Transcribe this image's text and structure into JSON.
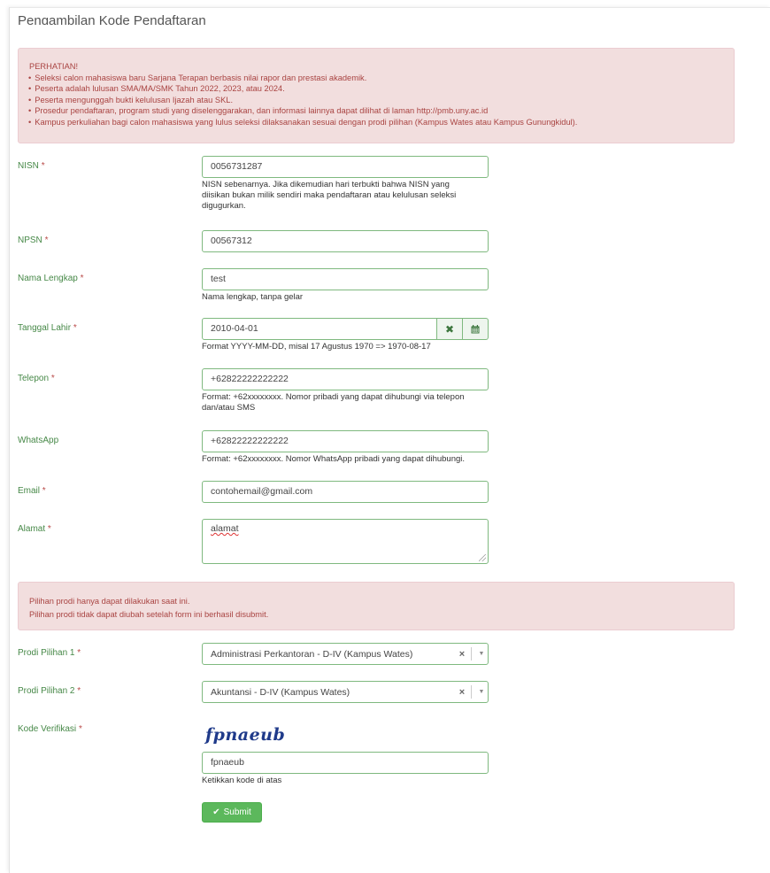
{
  "page": {
    "title": "Pengambilan Kode Pendaftaran"
  },
  "notice": {
    "heading": "PERHATIAN!",
    "items": [
      "Seleksi calon mahasiswa baru Sarjana Terapan berbasis nilai rapor dan prestasi akademik.",
      "Peserta adalah lulusan SMA/MA/SMK Tahun 2022, 2023, atau 2024.",
      "Peserta mengunggah bukti kelulusan Ijazah atau SKL.",
      "Prosedur pendaftaran, program studi yang diselenggarakan, dan informasi lainnya dapat dilihat di laman http://pmb.uny.ac.id",
      "Kampus perkuliahan bagi calon mahasiswa yang lulus seleksi dilaksanakan sesuai dengan prodi pilihan (Kampus Wates atau Kampus Gunungkidul)."
    ]
  },
  "form": {
    "required_mark": "*",
    "nisn": {
      "label": "NISN",
      "value": "0056731287",
      "help": "NISN sebenarnya. Jika dikemudian hari terbukti bahwa NISN yang diisikan bukan milik sendiri maka pendaftaran atau kelulusan seleksi digugurkan."
    },
    "npsn": {
      "label": "NPSN",
      "value": "00567312"
    },
    "nama": {
      "label": "Nama Lengkap",
      "value": "test",
      "help": "Nama lengkap, tanpa gelar"
    },
    "tanggal": {
      "label": "Tanggal Lahir",
      "value": "2010-04-01",
      "help": "Format YYYY-MM-DD, misal 17 Agustus 1970 => 1970-08-17",
      "clear_icon": "times-icon",
      "calendar_icon": "calendar-icon"
    },
    "telepon": {
      "label": "Telepon",
      "value": "+62822222222222",
      "help": "Format: +62xxxxxxxx. Nomor pribadi yang dapat dihubungi via telepon dan/atau SMS"
    },
    "whatsapp": {
      "label": "WhatsApp",
      "value": "+62822222222222",
      "help": "Format: +62xxxxxxxx. Nomor WhatsApp pribadi yang dapat dihubungi."
    },
    "email": {
      "label": "Email",
      "value": "contohemail@gmail.com"
    },
    "alamat": {
      "label": "Alamat",
      "value": "alamat"
    },
    "prodi_notice": [
      "Pilihan prodi hanya dapat dilakukan saat ini.",
      "Pilihan prodi tidak dapat diubah setelah form ini berhasil disubmit."
    ],
    "prodi1": {
      "label": "Prodi Pilihan 1",
      "value": "Administrasi Perkantoran - D-IV (Kampus Wates)"
    },
    "prodi2": {
      "label": "Prodi Pilihan 2",
      "value": "Akuntansi - D-IV (Kampus Wates)"
    },
    "kode": {
      "label": "Kode Verifikasi",
      "captcha": "fpnaeub",
      "value": "fpnaeub",
      "help": "Ketikkan kode di atas"
    },
    "submit_label": "Submit"
  },
  "colors": {
    "label_green": "#468847",
    "required_red": "#b94a48",
    "alert_bg": "#f2dede",
    "alert_text": "#a94442",
    "submit_green": "#5cb85c"
  }
}
